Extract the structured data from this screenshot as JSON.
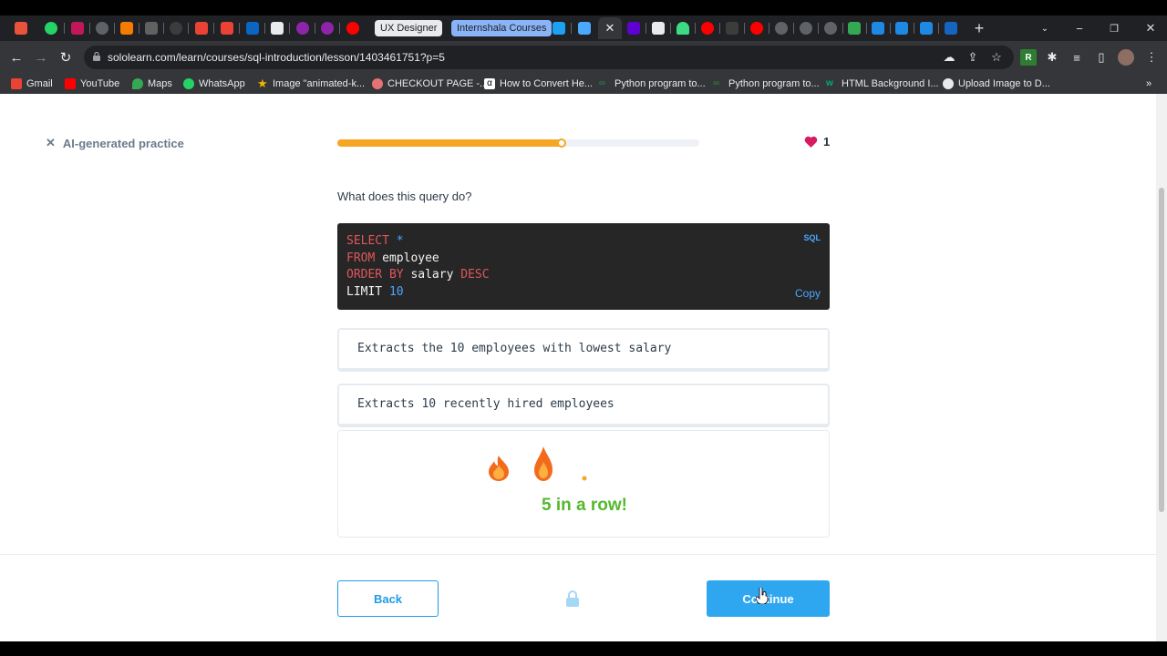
{
  "browser": {
    "tab_groups": [
      {
        "label": "UX Designer",
        "color": "#e8eaed"
      },
      {
        "label": "Internshala Courses",
        "color": "#8ab4f8"
      }
    ],
    "url": "sololearn.com/learn/courses/sql-introduction/lesson/1403461751?p=5",
    "bookmarks": [
      {
        "label": "Gmail",
        "icon": "gmail-icon",
        "color": "#ea4335"
      },
      {
        "label": "YouTube",
        "icon": "youtube-icon",
        "color": "#ff0000"
      },
      {
        "label": "Maps",
        "icon": "maps-icon",
        "color": "#34a853"
      },
      {
        "label": "WhatsApp",
        "icon": "whatsapp-icon",
        "color": "#25d366"
      },
      {
        "label": "Image \"animated-k...",
        "icon": "star-icon",
        "color": "#f4b400"
      },
      {
        "label": "CHECKOUT PAGE -...",
        "icon": "lips-icon",
        "color": "#e57373"
      },
      {
        "label": "How to Convert He...",
        "icon": "alpha-icon",
        "color": "#ffffff"
      },
      {
        "label": "Python program to...",
        "icon": "gfg-icon",
        "color": "#2f8d46"
      },
      {
        "label": "Python program to...",
        "icon": "gfg-icon",
        "color": "#2f8d46"
      },
      {
        "label": "HTML Background I...",
        "icon": "w3-icon",
        "color": "#04aa6d"
      },
      {
        "label": "Upload Image to D...",
        "icon": "globe-icon",
        "color": "#e8eaed"
      }
    ],
    "overflow_label": "»"
  },
  "lesson": {
    "close_label": "AI-generated practice",
    "progress": 0.62,
    "lives": "1",
    "question": "What does this query do?",
    "code": {
      "language": "SQL",
      "copy_label": "Copy",
      "lines": [
        {
          "kw1": "SELECT ",
          "rest": "",
          "num": "*",
          "kw2": ""
        },
        {
          "kw1": "FROM ",
          "rest": "employee",
          "num": "",
          "kw2": ""
        },
        {
          "kw1": "ORDER BY ",
          "rest": "salary ",
          "num": "",
          "kw2": "DESC"
        },
        {
          "kw1": "",
          "rest": "LIMIT ",
          "num": "10",
          "kw2": ""
        }
      ]
    },
    "options": [
      "Extracts the 10 employees with lowest salary",
      "Extracts 10 recently hired employees"
    ],
    "streak_text": "5 in a row!"
  },
  "footer": {
    "back_label": "Back",
    "continue_label": "Continue"
  },
  "colors": {
    "accent": "#2fa7f0",
    "progress": "#f5a623",
    "streak": "#54b92e",
    "heart": "#d81b60"
  }
}
